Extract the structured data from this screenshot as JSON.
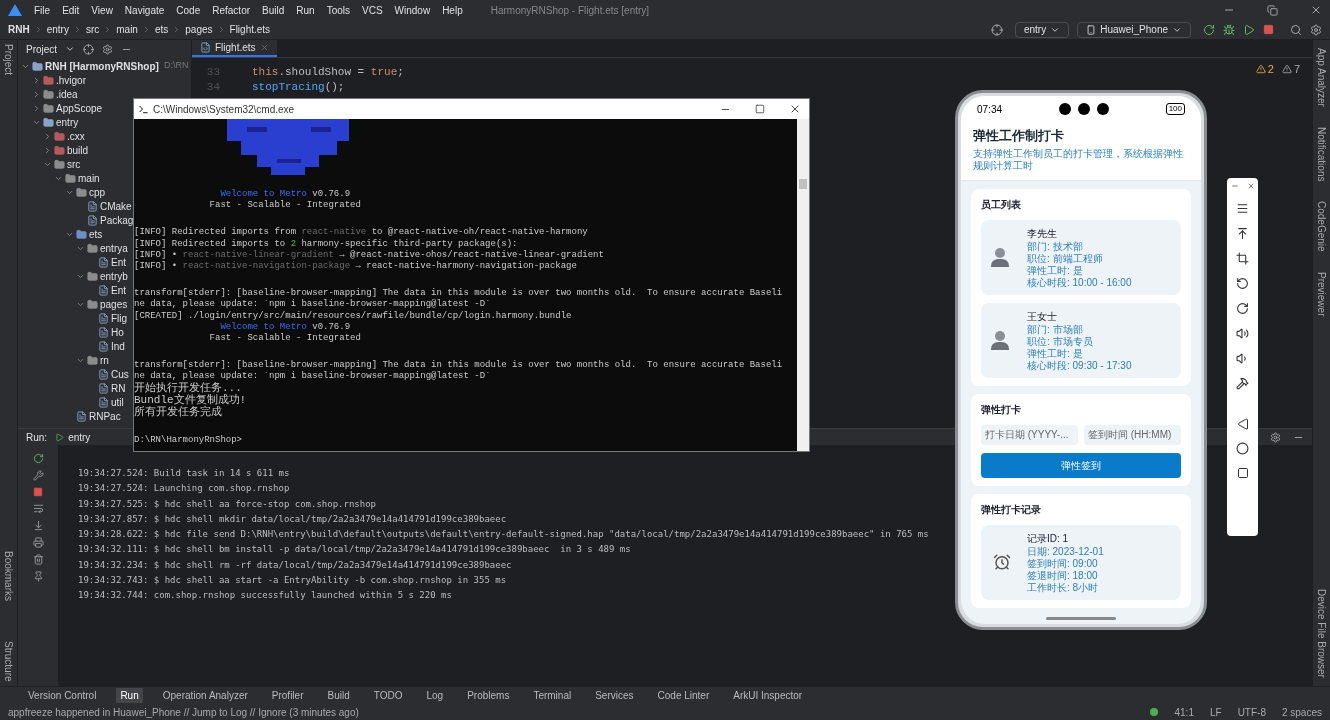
{
  "window": {
    "title": "HarmonyRNShop - Flight.ets [entry]"
  },
  "menu": [
    "File",
    "Edit",
    "View",
    "Navigate",
    "Code",
    "Refactor",
    "Build",
    "Run",
    "Tools",
    "VCS",
    "Window",
    "Help"
  ],
  "breadcrumb": [
    "RNH",
    "entry",
    "src",
    "main",
    "ets",
    "pages",
    "Flight.ets"
  ],
  "run_config": {
    "module": "entry",
    "device": "Huawei_Phone"
  },
  "project_panel": {
    "title": "Project",
    "tree": [
      {
        "name": "RNH [HarmonyRNShop]",
        "suffix": "D:\\RN",
        "kind": "module",
        "expanded": true,
        "children": [
          {
            "name": ".hvigor",
            "kind": "excluded",
            "expanded": false
          },
          {
            "name": ".idea",
            "kind": "folder",
            "expanded": false
          },
          {
            "name": "AppScope",
            "kind": "folder",
            "expanded": false
          },
          {
            "name": "entry",
            "kind": "module",
            "expanded": true,
            "children": [
              {
                "name": ".cxx",
                "kind": "excluded",
                "expanded": false
              },
              {
                "name": "build",
                "kind": "excluded",
                "expanded": false
              },
              {
                "name": "src",
                "kind": "folder",
                "expanded": true,
                "children": [
                  {
                    "name": "main",
                    "kind": "folder",
                    "expanded": true,
                    "children": [
                      {
                        "name": "cpp",
                        "kind": "folder",
                        "expanded": true,
                        "children": [
                          {
                            "name": "CMake",
                            "kind": "file"
                          },
                          {
                            "name": "Packag",
                            "kind": "file"
                          }
                        ]
                      },
                      {
                        "name": "ets",
                        "kind": "source",
                        "expanded": true,
                        "children": [
                          {
                            "name": "entrya",
                            "kind": "folder",
                            "expanded": true,
                            "children": [
                              {
                                "name": "Ent",
                                "kind": "file"
                              }
                            ]
                          },
                          {
                            "name": "entryb",
                            "kind": "folder",
                            "expanded": true,
                            "children": [
                              {
                                "name": "Ent",
                                "kind": "file"
                              }
                            ]
                          },
                          {
                            "name": "pages",
                            "kind": "folder",
                            "expanded": true,
                            "children": [
                              {
                                "name": "Flig",
                                "kind": "file"
                              },
                              {
                                "name": "Ho",
                                "kind": "file"
                              },
                              {
                                "name": "Ind",
                                "kind": "file"
                              }
                            ]
                          },
                          {
                            "name": "rn",
                            "kind": "folder",
                            "expanded": true,
                            "children": [
                              {
                                "name": "Cus",
                                "kind": "file"
                              },
                              {
                                "name": "RN",
                                "kind": "file"
                              },
                              {
                                "name": "util",
                                "kind": "file"
                              }
                            ]
                          }
                        ]
                      },
                      {
                        "name": "RNPac",
                        "kind": "file"
                      }
                    ]
                  }
                ]
              }
            ]
          }
        ]
      }
    ]
  },
  "editor": {
    "tab": "Flight.ets",
    "warnings": "2",
    "weak_warnings": "7",
    "lines": [
      {
        "number": "33",
        "tokens": [
          {
            "text": "this",
            "kind": "keyword"
          },
          {
            "text": ".shouldShow = ",
            "kind": "plain"
          },
          {
            "text": "true",
            "kind": "keyword"
          },
          {
            "text": ";",
            "kind": "plain"
          }
        ]
      },
      {
        "number": "34",
        "tokens": [
          {
            "text": "stopTracing",
            "kind": "function"
          },
          {
            "text": "();",
            "kind": "plain"
          }
        ]
      }
    ]
  },
  "terminal": {
    "title": "C:\\Windows\\System32\\cmd.exe",
    "blocks": [
      [
        [
          {
            "text": "                Welcome to Metro",
            "kind": "blue"
          },
          {
            "text": " v0.76.9",
            "kind": "plain"
          }
        ],
        [
          {
            "text": "              Fast - Scalable - Integrated",
            "kind": "plain"
          }
        ]
      ],
      [
        [
          {
            "text": "[INFO] Redirected imports from ",
            "kind": "plain"
          },
          {
            "text": "react-native",
            "kind": "dim"
          },
          {
            "text": " to @react-native-oh/react-native-harmony",
            "kind": "plain"
          }
        ],
        [
          {
            "text": "[INFO] Redirected imports to ",
            "kind": "plain"
          },
          {
            "text": "2",
            "kind": "green"
          },
          {
            "text": " harmony-specific third-party package(s):",
            "kind": "plain"
          }
        ],
        [
          {
            "text": "[INFO] • ",
            "kind": "plain"
          },
          {
            "text": "react-native-linear-gradient",
            "kind": "dim"
          },
          {
            "text": " → @react-native-ohos/react-native-linear-gradient",
            "kind": "plain"
          }
        ],
        [
          {
            "text": "[INFO] • ",
            "kind": "plain"
          },
          {
            "text": "react-native-navigation-package",
            "kind": "dim"
          },
          {
            "text": " → react-native-harmony-navigation-package",
            "kind": "plain"
          }
        ]
      ],
      [
        [
          {
            "text": "transform[stderr]: [baseline-browser-mapping] The data in this module is over two months old.  To ensure accurate Baseli",
            "kind": "plain"
          }
        ],
        [
          {
            "text": "ne data, please update: `npm i baseline-browser-mapping@latest -D`",
            "kind": "plain"
          }
        ],
        [
          {
            "text": "[CREATED] ./login/entry/src/main/resources/rawfile/bundle/cp/login.harmony.bundle",
            "kind": "plain"
          }
        ],
        [
          {
            "text": "                Welcome to Metro",
            "kind": "blue"
          },
          {
            "text": " v0.76.9",
            "kind": "plain"
          }
        ],
        [
          {
            "text": "              Fast - Scalable - Integrated",
            "kind": "plain"
          }
        ]
      ],
      [
        [
          {
            "text": "transform[stderr]: [baseline-browser-mapping] The data in this module is over two months old.  To ensure accurate Baseli",
            "kind": "plain"
          }
        ],
        [
          {
            "text": "ne data, please update: `npm i baseline-browser-mapping@latest -D`",
            "kind": "plain"
          }
        ],
        [
          {
            "text": "开始执行开发任务...",
            "kind": "plain"
          }
        ],
        [
          {
            "text": "Bundle文件复制成功!",
            "kind": "plain"
          }
        ],
        [
          {
            "text": "所有开发任务完成",
            "kind": "plain"
          }
        ]
      ],
      [
        [
          {
            "text": "D:\\RN\\HarmonyRnShop>",
            "kind": "plain"
          }
        ]
      ]
    ]
  },
  "run_panel": {
    "label": "Run:",
    "tab": "entry",
    "log": [
      "19:34:27.524: Build task in 14 s 611 ms",
      "19:34:27.524: Launching com.shop.rnshop",
      "19:34:27.525: $ hdc shell aa force-stop com.shop.rnshop",
      "19:34:27.857: $ hdc shell mkdir data/local/tmp/2a2a3479e14a414791d199ce389baeec",
      "19:34:28.622: $ hdc file send D:\\RNH\\entry\\build\\default\\outputs\\default\\entry-default-signed.hap \"data/local/tmp/2a2a3479e14a414791d199ce389baeec\" in 765 ms",
      "19:34:32.111: $ hdc shell bm install -p data/local/tmp/2a2a3479e14a414791d199ce389baeec  in 3 s 489 ms",
      "19:34:32.234: $ hdc shell rm -rf data/local/tmp/2a2a3479e14a414791d199ce389baeec",
      "19:34:32.743: $ hdc shell aa start -a EntryAbility -b com.shop.rnshop in 355 ms",
      "19:34:32.744: com.shop.rnshop successfully launched within 5 s 220 ms"
    ]
  },
  "left_strip": [
    "Project",
    "Bookmarks",
    "Structure"
  ],
  "right_strip": [
    "App Analyzer",
    "Notifications",
    "CodeGenie",
    "Previewer",
    "Device File Browser"
  ],
  "phone": {
    "time": "07:34",
    "battery": "100",
    "app": {
      "title": "弹性工作制打卡",
      "subtitle": "支持弹性工作制员工的打卡管理，系统根据弹性规则计算工时",
      "employees_title": "员工列表",
      "employees": [
        {
          "name": "李先生",
          "lines": [
            "部门: 技术部",
            "职位: 前端工程师",
            "弹性工时: 是",
            "核心时段: 10:00 - 16:00"
          ]
        },
        {
          "name": "王女士",
          "lines": [
            "部门: 市场部",
            "职位: 市场专员",
            "弹性工时: 是",
            "核心时段: 09:30 - 17:30"
          ]
        }
      ],
      "punch_title": "弹性打卡",
      "date_field": {
        "placeholder": "打卡日期 (YYYY-..."
      },
      "time_field": {
        "placeholder": "签到时间 (HH:MM)"
      },
      "punch_button": "弹性签到",
      "records_title": "弹性打卡记录",
      "records": [
        {
          "title": "记录ID: 1",
          "lines": [
            "日期: 2023-12-01",
            "签到时间: 09:00",
            "签退时间: 18:00",
            "工作时长: 8小时"
          ]
        }
      ]
    }
  },
  "tool_tabs": [
    {
      "label": "Version Control",
      "selected": false
    },
    {
      "label": "Run",
      "selected": true
    },
    {
      "label": "Operation Analyzer",
      "selected": false
    },
    {
      "label": "Profiler",
      "selected": false
    },
    {
      "label": "Build",
      "selected": false
    },
    {
      "label": "TODO",
      "selected": false
    },
    {
      "label": "Log",
      "selected": false
    },
    {
      "label": "Problems",
      "selected": false
    },
    {
      "label": "Terminal",
      "selected": false
    },
    {
      "label": "Services",
      "selected": false
    },
    {
      "label": "Code Linter",
      "selected": false
    },
    {
      "label": "ArkUI Inspector",
      "selected": false
    }
  ],
  "status_bar": {
    "message": "appfreeze happened in Huawei_Phone // Jump to Log // Ignore (3 minutes ago)",
    "position": "41:1",
    "line_ending": "LF",
    "encoding": "UTF-8",
    "indent": "2 spaces"
  }
}
